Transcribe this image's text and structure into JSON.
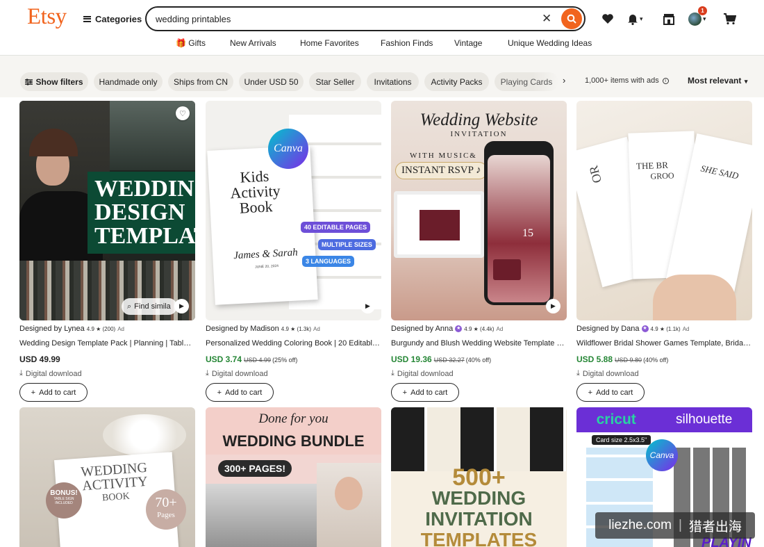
{
  "header": {
    "logo": "Etsy",
    "categories_label": "Categories",
    "search_value": "wedding printables",
    "cart_badge": "1"
  },
  "subnav": [
    "Gifts",
    "New Arrivals",
    "Home Favorites",
    "Fashion Finds",
    "Vintage",
    "Unique Wedding Ideas"
  ],
  "filters": {
    "show_filters": "Show filters",
    "chips": [
      "Handmade only",
      "Ships from CN",
      "Under USD 50",
      "Star Seller",
      "Invitations",
      "Activity Packs",
      "Playing Cards"
    ],
    "results": "1,000+ items with ads",
    "sort": "Most relevant"
  },
  "products": [
    {
      "shop": "Designed by Lynea",
      "rating": "4.9 ★ (200)",
      "ad": "Ad",
      "title": "Wedding Design Template Pack | Planning | Tables...",
      "price": "USD 49.99",
      "old_price": "",
      "discount": "",
      "download": "Digital download",
      "cart": "Add to cart",
      "thumb_text": [
        "WEDDING",
        "DESIGN",
        "TEMPLAT"
      ],
      "find_similar": "Find simila"
    },
    {
      "shop": "Designed by Madison",
      "rating": "4.9 ★ (1.3k)",
      "ad": "Ad",
      "title": "Personalized Wedding Coloring Book | 20 Editable...",
      "price": "USD 3.74",
      "old_price": "USD 4.99",
      "discount": "(25% off)",
      "download": "Digital download",
      "cart": "Add to cart",
      "thumb_text": [
        "Kids",
        "Activity",
        "Book",
        "James & Sarah",
        "JUNE 20, 2024",
        "Canva",
        "40 EDITABLE PAGES",
        "MULTIPLE SIZES",
        "3 LANGUAGES"
      ]
    },
    {
      "shop": "Designed by Anna",
      "rating": "4.9 ★ (4.4k)",
      "ad": "Ad",
      "title": "Burgundy and Blush Wedding Website Template w...",
      "price": "USD 19.36",
      "old_price": "USD 32.27",
      "discount": "(40% off)",
      "download": "Digital download",
      "cart": "Add to cart",
      "thumb_text": [
        "Wedding Website",
        "INVITATION",
        "WITH MUSIC&",
        "INSTANT RSVP",
        "15"
      ]
    },
    {
      "shop": "Designed by Dana",
      "rating": "4.9 ★ (1.1k)",
      "ad": "Ad",
      "title": "Wildflower Bridal Shower Games Template, Bridal ...",
      "price": "USD 5.88",
      "old_price": "USD 9.80",
      "discount": "(40% off)",
      "download": "Digital download",
      "cart": "Add to cart",
      "thumb_text": [
        "THE BR",
        "GROO",
        "OR",
        "SHE SAID"
      ]
    }
  ],
  "row2": [
    {
      "thumb_text": [
        "WEDDING",
        "ACTIVITY",
        "BOOK",
        "70+",
        "Pages",
        "BONUS!",
        "TABLE SIGN INCLUDED"
      ]
    },
    {
      "thumb_text": [
        "Done for you",
        "WEDDING BUNDLE",
        "300+ PAGES!"
      ]
    },
    {
      "thumb_text": [
        "500+",
        "WEDDING",
        "INVITATION",
        "TEMPLATES"
      ]
    },
    {
      "thumb_text": [
        "cricut",
        "silhouette",
        "Card size 2.5x3.5\"",
        "Canva",
        "PLAYING"
      ]
    }
  ],
  "watermark": {
    "left": "liezhe.com",
    "right": "猎者出海"
  },
  "colors": {
    "brand": "#f1641e",
    "sale": "#258635",
    "chip_bg": "#eae8e3",
    "filter_bg": "#f6f5f2"
  }
}
